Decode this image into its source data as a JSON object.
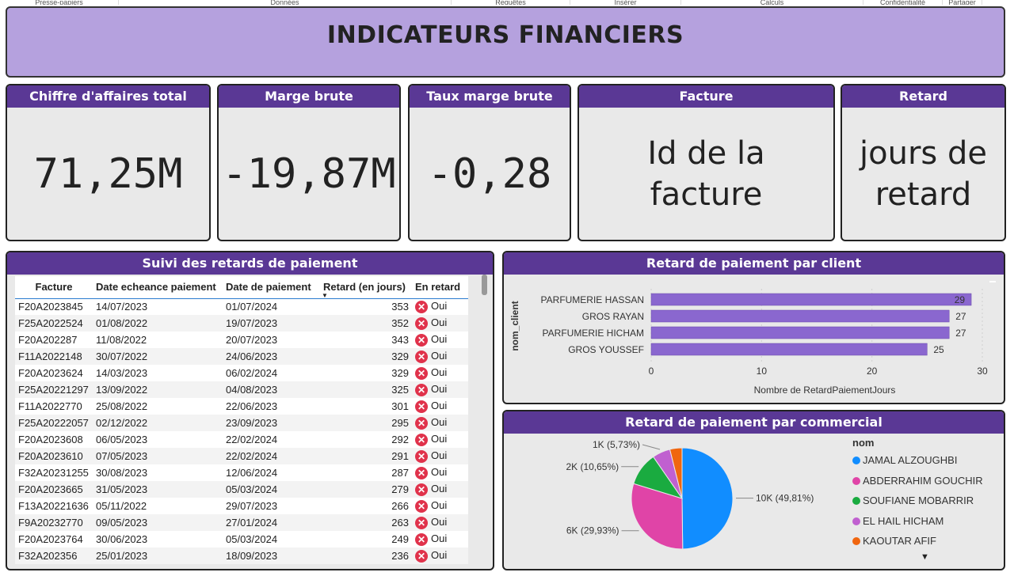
{
  "ribbon": [
    "Presse-papiers",
    "Données",
    "Requêtes",
    "Insérer",
    "Calculs",
    "Confidentialité",
    "Partager"
  ],
  "title": "INDICATEURS FINANCIERS",
  "cards": [
    {
      "label": "Chiffre d'affaires total",
      "value": "71,25M"
    },
    {
      "label": "Marge brute",
      "value": "-19,87M"
    },
    {
      "label": "Taux marge brute",
      "value": "-0,28"
    },
    {
      "label": "Facture",
      "value": "Id de la facture"
    },
    {
      "label": "Retard",
      "value": "jours de retard"
    }
  ],
  "table": {
    "title": "Suivi des retards de paiement",
    "columns": [
      "Facture",
      "Date echeance paiement",
      "Date de paiement",
      "Retard (en jours)",
      "En retard"
    ],
    "rows": [
      [
        "F20A2023845",
        "14/07/2023",
        "01/07/2024",
        "353",
        "Oui"
      ],
      [
        "F25A2022524",
        "01/08/2022",
        "19/07/2023",
        "352",
        "Oui"
      ],
      [
        "F20A202287",
        "11/08/2022",
        "20/07/2023",
        "343",
        "Oui"
      ],
      [
        "F11A2022148",
        "30/07/2022",
        "24/06/2023",
        "329",
        "Oui"
      ],
      [
        "F20A2023624",
        "14/03/2023",
        "06/02/2024",
        "329",
        "Oui"
      ],
      [
        "F25A20221297",
        "13/09/2022",
        "04/08/2023",
        "325",
        "Oui"
      ],
      [
        "F11A2022770",
        "25/08/2022",
        "22/06/2023",
        "301",
        "Oui"
      ],
      [
        "F25A20222057",
        "02/12/2022",
        "23/09/2023",
        "295",
        "Oui"
      ],
      [
        "F20A2023608",
        "06/05/2023",
        "22/02/2024",
        "292",
        "Oui"
      ],
      [
        "F20A2023610",
        "07/05/2023",
        "22/02/2024",
        "291",
        "Oui"
      ],
      [
        "F32A20231255",
        "30/08/2023",
        "12/06/2024",
        "287",
        "Oui"
      ],
      [
        "F20A2023665",
        "31/05/2023",
        "05/03/2024",
        "279",
        "Oui"
      ],
      [
        "F13A20221636",
        "05/11/2022",
        "29/07/2023",
        "266",
        "Oui"
      ],
      [
        "F9A20232770",
        "09/05/2023",
        "27/01/2024",
        "263",
        "Oui"
      ],
      [
        "F20A2023764",
        "30/06/2023",
        "05/03/2024",
        "249",
        "Oui"
      ],
      [
        "F32A202356",
        "25/01/2023",
        "18/09/2023",
        "236",
        "Oui"
      ]
    ]
  },
  "chart_data": [
    {
      "type": "bar",
      "orientation": "horizontal",
      "title": "Retard de paiement par client",
      "categories": [
        "PARFUMERIE HASSAN",
        "GROS RAYAN",
        "PARFUMERIE HICHAM",
        "GROS YOUSSEF"
      ],
      "values": [
        29,
        27,
        27,
        25
      ],
      "xlabel": "Nombre de RetardPaiementJours",
      "ylabel": "nom_client",
      "xticks": [
        "0",
        "10",
        "20",
        "30"
      ],
      "xlim": [
        0,
        30
      ],
      "color": "#8a67cf",
      "grid": true
    },
    {
      "type": "pie",
      "title": "Retard de paiement par commercial",
      "legend_title": "nom",
      "labels": [
        "JAMAL ALZOUGHBI",
        "ABDERRAHIM GOUCHIR",
        "SOUFIANE MOBARRIR",
        "EL HAIL HICHAM",
        "KAOUTAR AFIF"
      ],
      "values": [
        49.81,
        29.93,
        10.65,
        5.73,
        3.88
      ],
      "colors": [
        "#118dff",
        "#e044a7",
        "#1aab40",
        "#c060d0",
        "#f0660f"
      ],
      "data_labels": [
        "10K (49,81%)",
        "6K (29,93%)",
        "2K (10,65%)",
        "1K (5,73%)",
        ""
      ],
      "legend_position": "right"
    }
  ]
}
